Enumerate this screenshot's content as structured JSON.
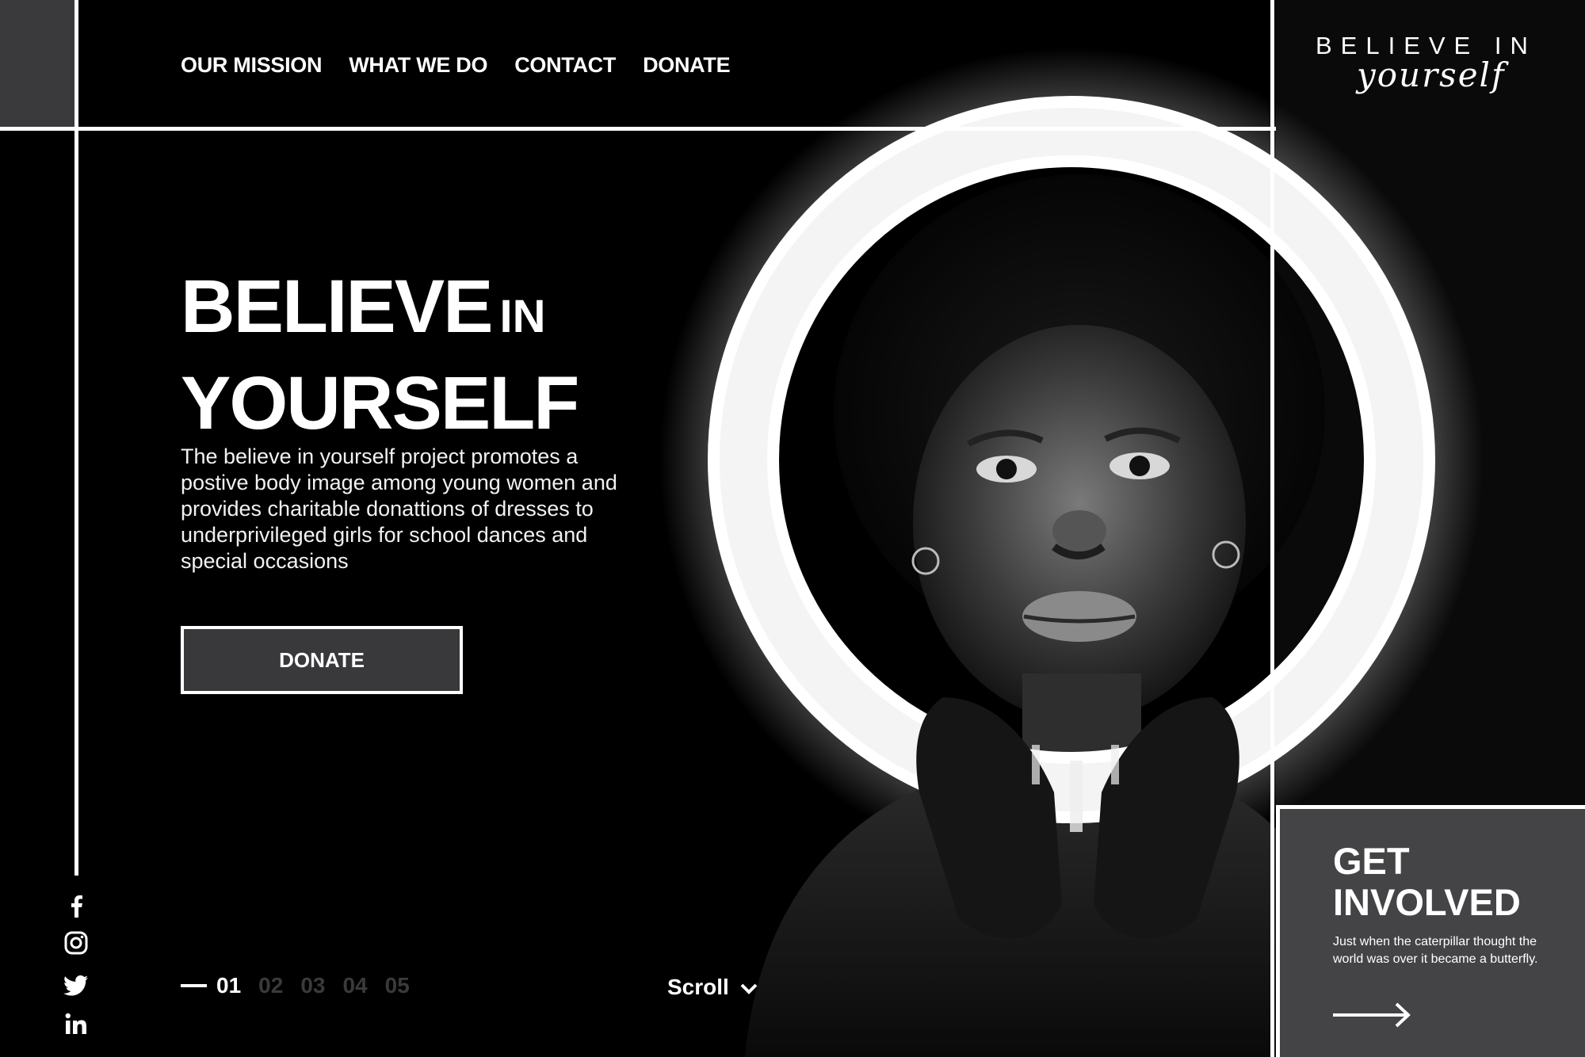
{
  "nav": {
    "items": [
      {
        "label": "OUR MISSION"
      },
      {
        "label": "WHAT WE DO"
      },
      {
        "label": "CONTACT"
      },
      {
        "label": "DONATE"
      }
    ]
  },
  "logo": {
    "line1": "BELIEVE IN",
    "line2": "yourself"
  },
  "hero": {
    "title_word1": "BELIEVE",
    "title_word2": "IN",
    "title_line2": "YOURSELF",
    "description": "The believe in yourself project promotes a postive body image among young women and provides charitable donattions of dresses to underprivileged girls for school dances and special occasions",
    "donate_label": "DONATE"
  },
  "social": [
    "facebook-icon",
    "instagram-icon",
    "twitter-icon",
    "linkedin-icon"
  ],
  "pager": {
    "pages": [
      "01",
      "02",
      "03",
      "04",
      "05"
    ],
    "current": "01"
  },
  "scroll": {
    "label": "Scroll"
  },
  "card": {
    "title_line1": "GET",
    "title_line2": "INVOLVED",
    "text": "Just when the caterpillar thought the world was over it became a butterfly."
  },
  "colors": {
    "background": "#000000",
    "panel_gray": "#444446",
    "button_gray": "#39393b",
    "inactive_page": "#3a3a3a",
    "accent": "#ffffff"
  }
}
